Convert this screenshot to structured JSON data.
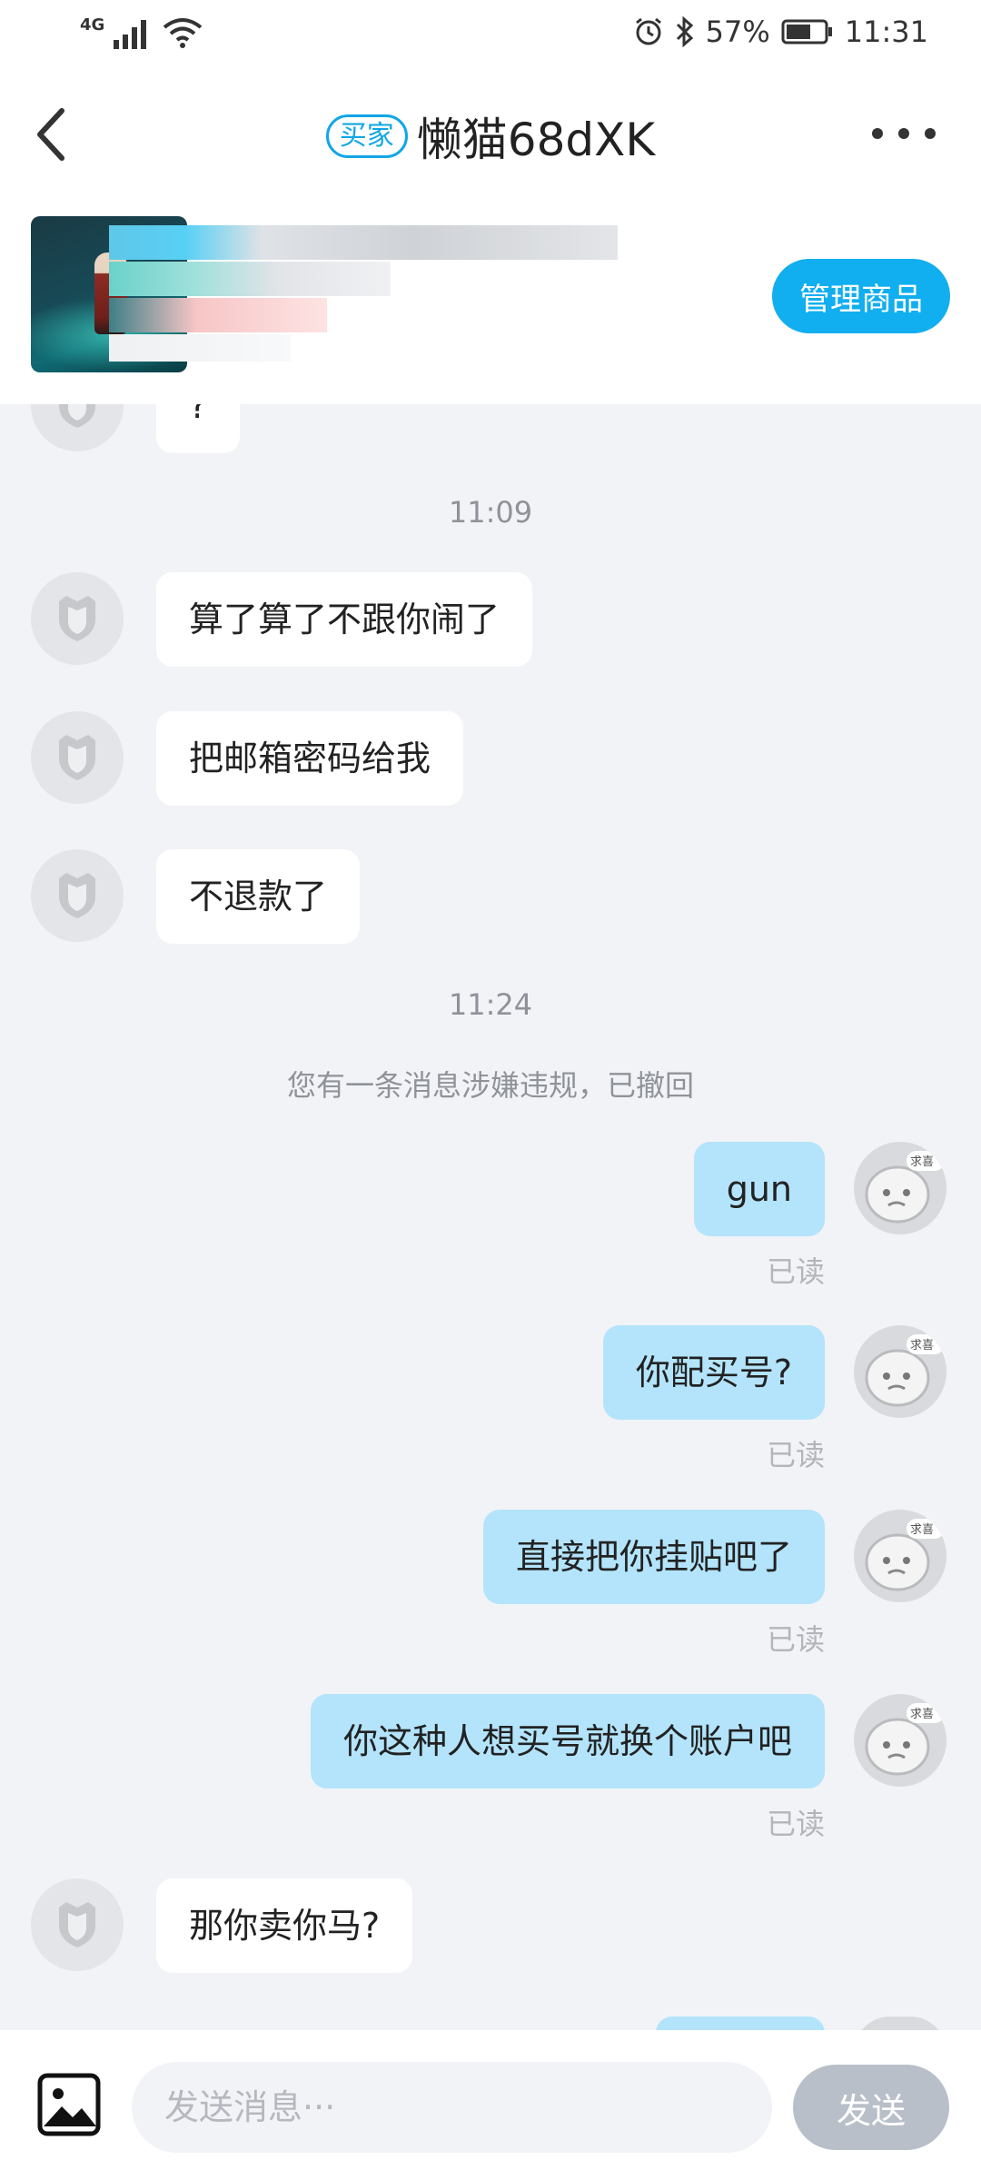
{
  "status_bar": {
    "network": "4G",
    "battery": "57%",
    "time": "11:31"
  },
  "header": {
    "role_badge": "买家",
    "title": "懒猫68dXK"
  },
  "product": {
    "manage_label": "管理商品"
  },
  "messages": [
    {
      "type": "in",
      "text": "?"
    },
    {
      "type": "time",
      "text": "11:09"
    },
    {
      "type": "in",
      "text": "算了算了不跟你闹了"
    },
    {
      "type": "in",
      "text": "把邮箱密码给我"
    },
    {
      "type": "in",
      "text": "不退款了"
    },
    {
      "type": "time",
      "text": "11:24"
    },
    {
      "type": "notice",
      "text": "您有一条消息涉嫌违规，已撤回"
    },
    {
      "type": "out",
      "text": "gun",
      "status": "已读"
    },
    {
      "type": "out",
      "text": "你配买号?",
      "status": "已读"
    },
    {
      "type": "out",
      "text": "直接把你挂贴吧了",
      "status": "已读"
    },
    {
      "type": "out",
      "text": "你这种人想买号就换个账户吧",
      "status": "已读"
    },
    {
      "type": "in",
      "text": "那你卖你马?"
    }
  ],
  "avatars": {
    "partner_icon": "shield-icon",
    "self_caption": "求喜"
  },
  "input": {
    "placeholder": "发送消息···",
    "send_label": "发送"
  },
  "colors": {
    "accent": "#11aef0",
    "outgoing_bubble": "#b3e4fb",
    "background": "#f2f3f7"
  }
}
